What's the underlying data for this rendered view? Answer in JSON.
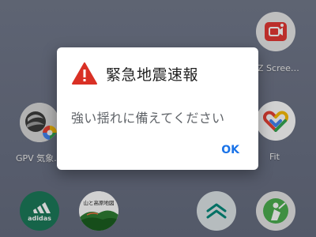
{
  "dialog": {
    "title": "緊急地震速報",
    "message": "強い揺れに備えてください",
    "ok_label": "OK",
    "accent_color": "#1a73e8",
    "warning_color": "#d93025"
  },
  "apps": [
    {
      "label": "Z Scree…",
      "icon": "screen-recorder-icon"
    },
    {
      "label": "GPV 気象…",
      "icon": "gpv-weather-icon"
    },
    {
      "label": "Fit",
      "icon": "google-fit-icon"
    },
    {
      "label": "",
      "icon": "adidas-icon"
    },
    {
      "label": "",
      "icon": "mountain-map-icon",
      "icon_text": "山と高原地図"
    },
    {
      "label": "",
      "icon": "chevrons-app-icon"
    },
    {
      "label": "",
      "icon": "golf-app-icon"
    }
  ]
}
